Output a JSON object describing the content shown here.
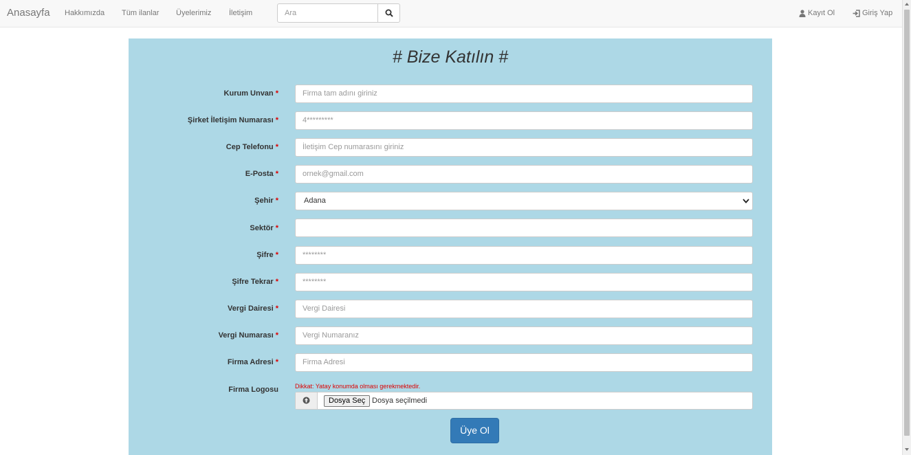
{
  "navbar": {
    "brand": "Anasayfa",
    "links": [
      "Hakkımızda",
      "Tüm ilanlar",
      "Üyelerimiz",
      "İletişim"
    ],
    "search_placeholder": "Ara",
    "register_label": "Kayıt Ol",
    "login_label": "Giriş Yap"
  },
  "form": {
    "title": "# Bize Katılın #",
    "required_marker": "*",
    "fields": [
      {
        "label": "Kurum Unvan",
        "placeholder": "Firma tam adını giriniz",
        "value": ""
      },
      {
        "label": "Şirket İletişim Numarası",
        "placeholder": "4*********",
        "value": ""
      },
      {
        "label": "Cep Telefonu",
        "placeholder": "İletişim Cep numarasını giriniz",
        "value": ""
      },
      {
        "label": "E-Posta",
        "placeholder": "ornek@gmail.com",
        "value": ""
      },
      {
        "label": "Şehir",
        "placeholder": "",
        "value": "Adana"
      },
      {
        "label": "Sektör",
        "placeholder": "",
        "value": ""
      },
      {
        "label": "Şifre",
        "placeholder": "********",
        "value": ""
      },
      {
        "label": "Şifre Tekrar",
        "placeholder": "********",
        "value": ""
      },
      {
        "label": "Vergi Dairesi",
        "placeholder": "Vergi Dairesi",
        "value": ""
      },
      {
        "label": "Vergi Numarası",
        "placeholder": "Vergi Numaranız",
        "value": ""
      },
      {
        "label": "Firma Adresi",
        "placeholder": "Firma Adresi",
        "value": ""
      }
    ],
    "logo_label": "Firma Logosu",
    "logo_hint": "Dikkat: Yatay konumda olması gerekmektedir.",
    "file_button": "Dosya Seç",
    "file_status": "Dosya seçilmedi",
    "submit_label": "Üye Ol"
  },
  "colors": {
    "panel_bg": "#add8e6",
    "submit_bg": "#337ab7",
    "required": "#dd0000"
  }
}
